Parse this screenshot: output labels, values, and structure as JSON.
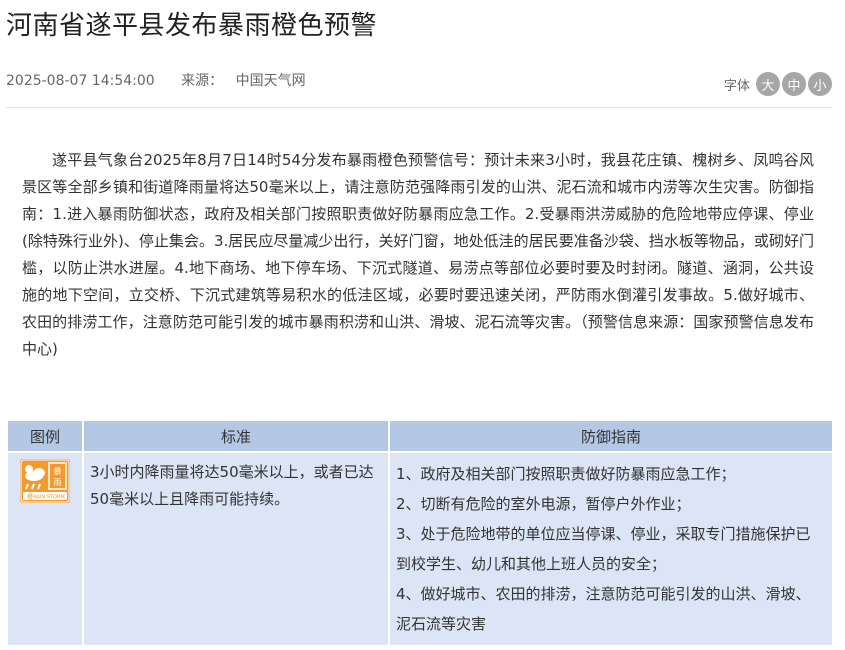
{
  "article": {
    "title": "河南省遂平县发布暴雨橙色预警",
    "datetime": "2025-08-07 14:54:00",
    "source_label": "来源：",
    "source_name": "中国天气网",
    "body": "遂平县气象台2025年8月7日14时54分发布暴雨橙色预警信号：预计未来3小时，我县花庄镇、槐树乡、凤鸣谷风景区等全部乡镇和街道降雨量将达50毫米以上，请注意防范强降雨引发的山洪、泥石流和城市内涝等次生灾害。防御指南：1.进入暴雨防御状态，政府及相关部门按照职责做好防暴雨应急工作。2.受暴雨洪涝威胁的危险地带应停课、停业(除特殊行业外)、停止集会。3.居民应尽量减少出行，关好门窗，地处低洼的居民要准备沙袋、挡水板等物品，或砌好门槛，以防止洪水进屋。4.地下商场、地下停车场、下沉式隧道、易涝点等部位必要时要及时封闭。隧道、涵洞，公共设施的地下空间，立交桥、下沉式建筑等易积水的低洼区域，必要时要迅速关闭，严防雨水倒灌引发事故。5.做好城市、农田的排涝工作，注意防范可能引发的城市暴雨积涝和山洪、滑坡、泥石流等灾害。（预警信息来源：国家预警信息发布中心)"
  },
  "font_size": {
    "label": "字体",
    "large": "大",
    "medium": "中",
    "small": "小"
  },
  "table": {
    "headers": [
      "图例",
      "标准",
      "防御指南"
    ],
    "icon": {
      "name": "rainstorm-orange-warning-icon",
      "text_cn": "暴雨",
      "text_en": "RAIN STORM",
      "level_char": "橙",
      "color": "#f29a2e"
    },
    "standard": "3小时内降雨量将达50毫米以上，或者已达50毫米以上且降雨可能持续。",
    "guide": [
      "1、政府及相关部门按照职责做好防暴雨应急工作；",
      "2、切断有危险的室外电源，暂停户外作业；",
      "3、处于危险地带的单位应当停课、停业，采取专门措施保护已到校学生、幼儿和其他上班人员的安全；",
      "4、做好城市、农田的排涝，注意防范可能引发的山洪、滑坡、泥石流等灾害"
    ]
  },
  "colors": {
    "header_bg": "#b4c7e4",
    "cell_bg": "#dbe5f5",
    "warning_orange": "#f29a2e"
  }
}
